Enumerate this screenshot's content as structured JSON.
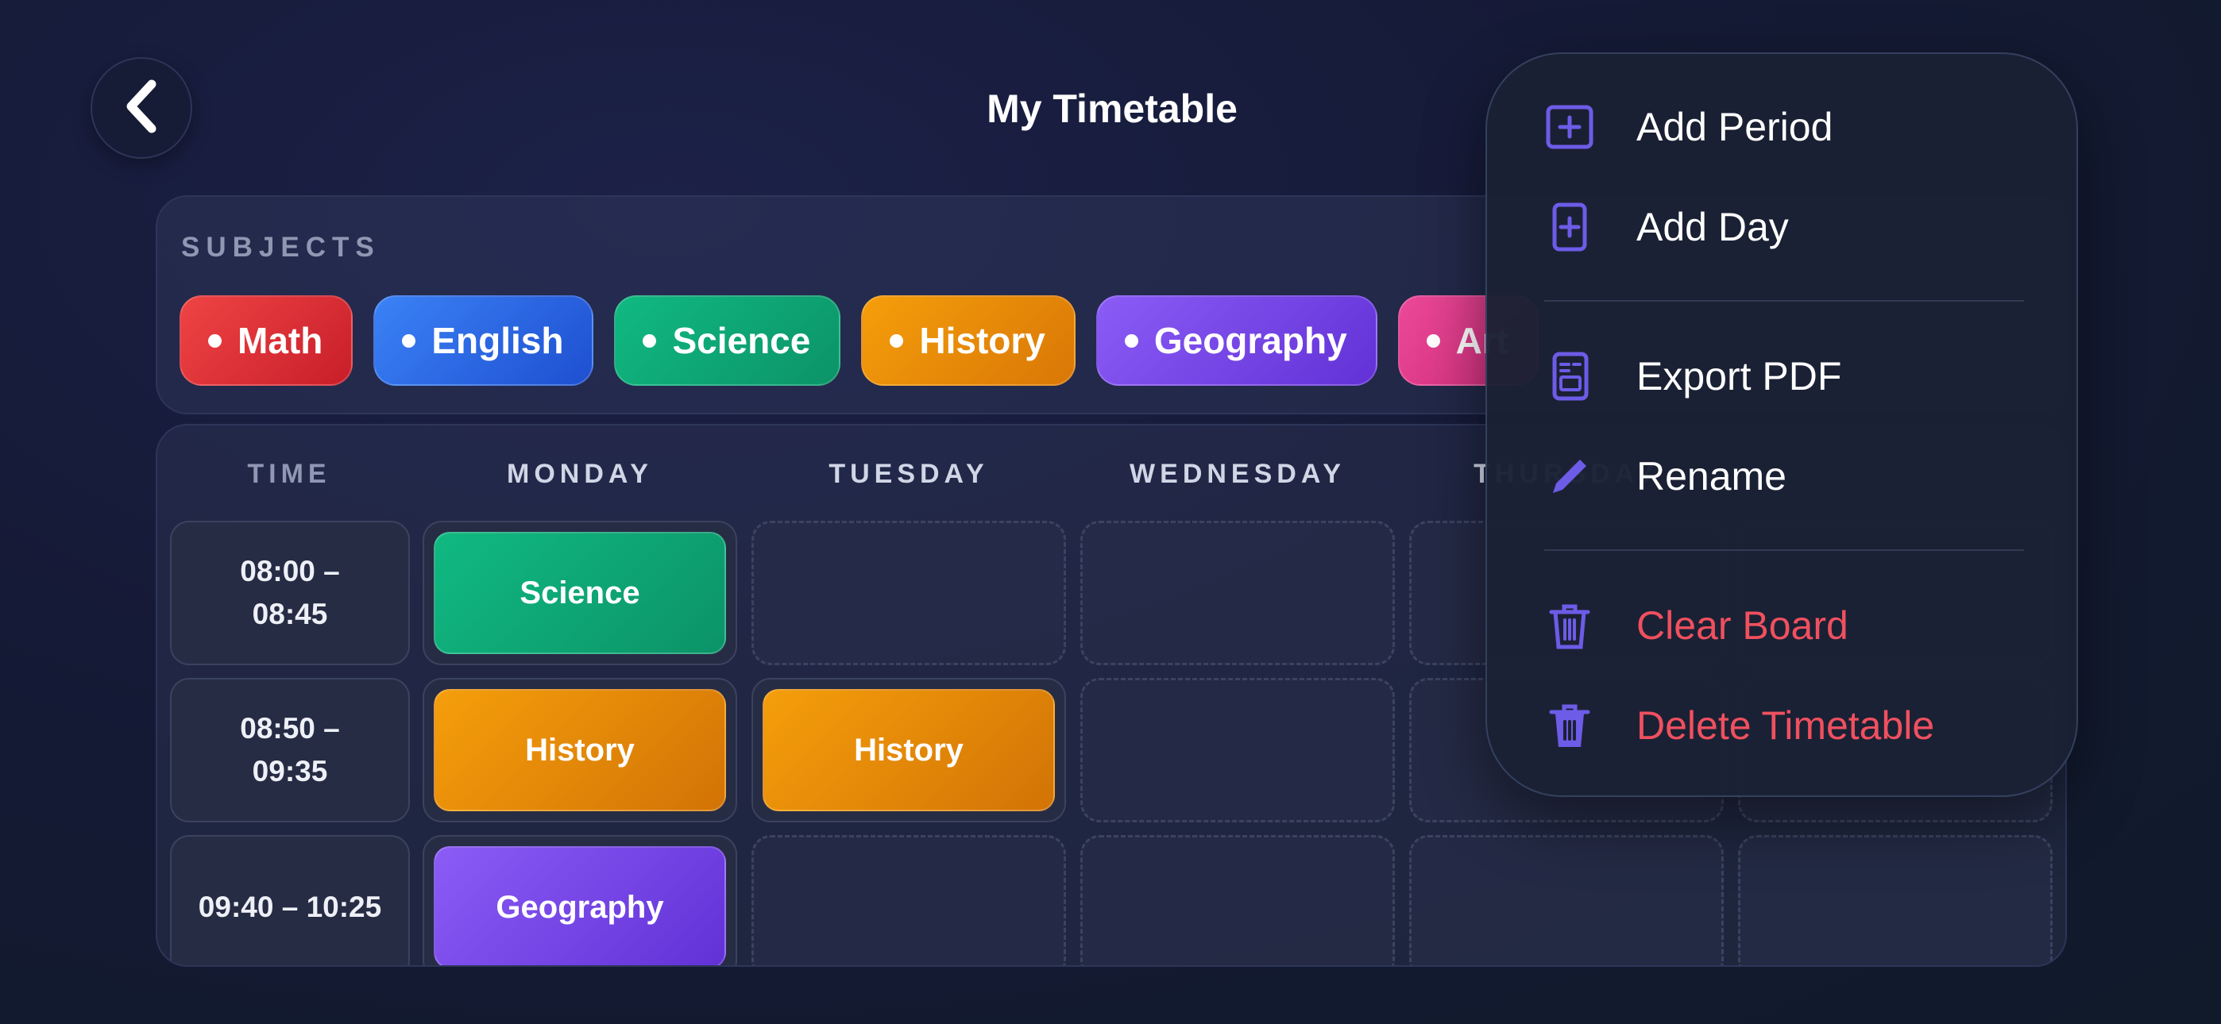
{
  "header": {
    "title": "My Timetable"
  },
  "subjects": {
    "label": "SUBJECTS",
    "chips": [
      {
        "label": "Math",
        "color": "#ef4444"
      },
      {
        "label": "English",
        "color": "#3b82f6"
      },
      {
        "label": "Science",
        "color": "#10b981"
      },
      {
        "label": "History",
        "color": "#f59e0b"
      },
      {
        "label": "Geography",
        "color": "#8b5cf6"
      },
      {
        "label": "Art",
        "color": "#ec4899"
      }
    ]
  },
  "grid": {
    "columns": [
      "TIME",
      "MONDAY",
      "TUESDAY",
      "WEDNESDAY",
      "THURSDAY"
    ],
    "rows": [
      {
        "time": "08:00 –\n08:45",
        "monday": "Science",
        "tuesday": ""
      },
      {
        "time": "08:50 –\n09:35",
        "monday": "History",
        "tuesday": "History"
      },
      {
        "time": "09:40 – 10:25",
        "monday": "Geography",
        "tuesday": ""
      }
    ]
  },
  "menu": {
    "items": [
      {
        "label": "Add Period",
        "icon": "plus-square-icon"
      },
      {
        "label": "Add Day",
        "icon": "plus-rect-icon"
      },
      {
        "label": "Export PDF",
        "icon": "document-icon"
      },
      {
        "label": "Rename",
        "icon": "pencil-icon"
      },
      {
        "label": "Clear Board",
        "icon": "trash-outline-icon"
      },
      {
        "label": "Delete Timetable",
        "icon": "trash-filled-icon"
      }
    ],
    "accent": "#6c5ce7",
    "danger_color": "#f0505f"
  }
}
